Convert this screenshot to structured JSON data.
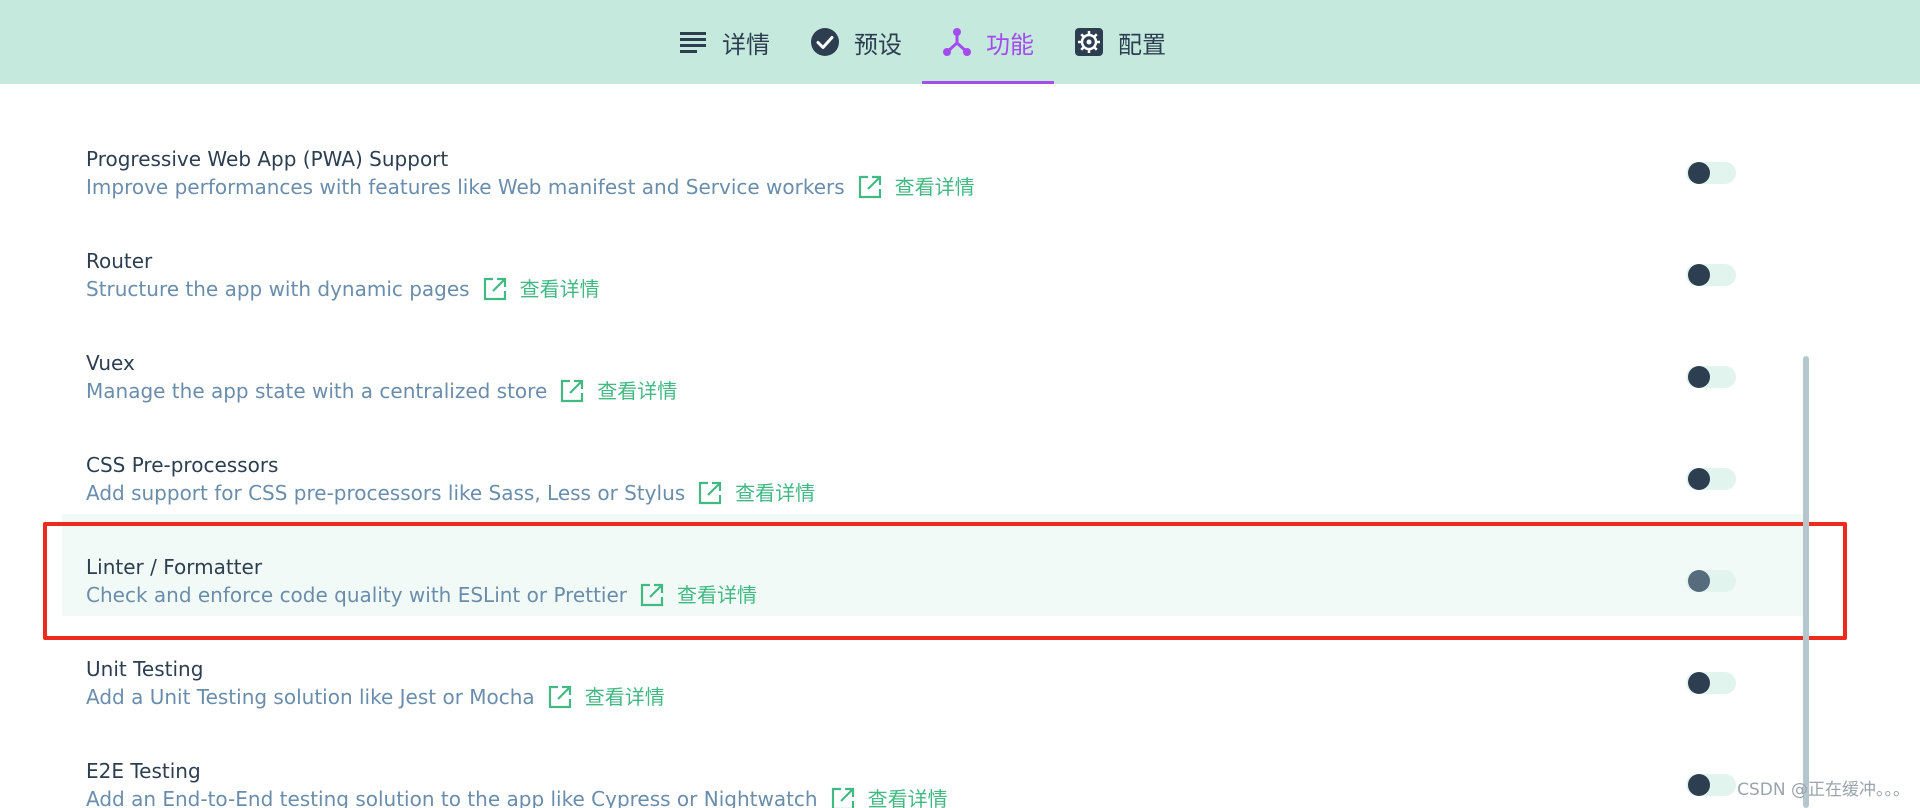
{
  "tabs": [
    {
      "label": "详情",
      "icon": "list-icon",
      "active": false
    },
    {
      "label": "预设",
      "icon": "check-circle-icon",
      "active": false
    },
    {
      "label": "功能",
      "icon": "fork-icon",
      "active": true
    },
    {
      "label": "配置",
      "icon": "gear-icon",
      "active": false
    }
  ],
  "features": [
    {
      "name": "Progressive Web App (PWA) Support",
      "description": "Improve performances with features like Web manifest and Service workers",
      "more_label": "查看详情",
      "enabled": false
    },
    {
      "name": "Router",
      "description": "Structure the app with dynamic pages",
      "more_label": "查看详情",
      "enabled": false
    },
    {
      "name": "Vuex",
      "description": "Manage the app state with a centralized store",
      "more_label": "查看详情",
      "enabled": false
    },
    {
      "name": "CSS Pre-processors",
      "description": "Add support for CSS pre-processors like Sass, Less or Stylus",
      "more_label": "查看详情",
      "enabled": false
    },
    {
      "name": "Linter / Formatter",
      "description": "Check and enforce code quality with ESLint or Prettier",
      "more_label": "查看详情",
      "enabled": false
    },
    {
      "name": "Unit Testing",
      "description": "Add a Unit Testing solution like Jest or Mocha",
      "more_label": "查看详情",
      "enabled": false
    },
    {
      "name": "E2E Testing",
      "description": "Add an End-to-End testing solution to the app like Cypress or Nightwatch",
      "more_label": "查看详情",
      "enabled": false
    }
  ],
  "watermark": "CSDN @正在缓冲。。。",
  "colors": {
    "topbar": "#c5e9dd",
    "accent": "#a44cf0",
    "link": "#42b983",
    "selection": "#ee2a1c"
  }
}
